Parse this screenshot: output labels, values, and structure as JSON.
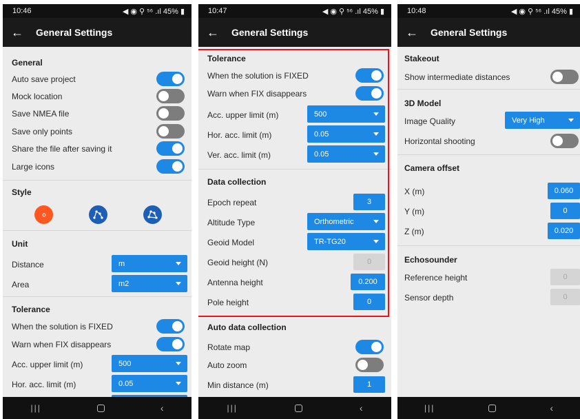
{
  "screen1": {
    "status": {
      "time": "10:46",
      "icons": "◀ ◉ ⚲ ⁵⁶ .ıl 45% ▮"
    },
    "title": "General Settings",
    "general": {
      "title": "General",
      "items": [
        {
          "label": "Auto save project",
          "on": true
        },
        {
          "label": "Mock location",
          "on": false
        },
        {
          "label": "Save NMEA file",
          "on": false
        },
        {
          "label": "Save only points",
          "on": false
        },
        {
          "label": "Share the file after saving it",
          "on": true
        },
        {
          "label": "Large icons",
          "on": true
        }
      ]
    },
    "style": {
      "title": "Style",
      "options": [
        {
          "icon": "point-style-icon",
          "color": "#ff5722"
        },
        {
          "icon": "line-style-icon",
          "color": "#1e5fb5"
        },
        {
          "icon": "polygon-style-icon",
          "color": "#1e5fb5"
        }
      ]
    },
    "unit": {
      "title": "Unit",
      "distance_label": "Distance",
      "distance_value": "m",
      "area_label": "Area",
      "area_value": "m2"
    },
    "tolerance": {
      "title": "Tolerance",
      "fixed_label": "When the solution is FIXED",
      "warn_label": "Warn when FIX disappears",
      "acc_label": "Acc. upper limit (m)",
      "acc_value": "500",
      "hor_label": "Hor. acc. limit (m)",
      "hor_value": "0.05"
    }
  },
  "screen2": {
    "status": {
      "time": "10:47",
      "icons": "◀ ◉ ⚲ ⁵⁶ .ıl 45% ▮"
    },
    "title": "General Settings",
    "tolerance": {
      "title": "Tolerance",
      "fixed_label": "When the solution is FIXED",
      "warn_label": "Warn when FIX disappears",
      "acc_label": "Acc. upper limit (m)",
      "acc_value": "500",
      "hor_label": "Hor. acc. limit (m)",
      "hor_value": "0.05",
      "ver_label": "Ver. acc. limit (m)",
      "ver_value": "0.05"
    },
    "data_collection": {
      "title": "Data collection",
      "epoch_label": "Epoch repeat",
      "epoch_value": "3",
      "altitude_label": "Altitude Type",
      "altitude_value": "Orthometric",
      "geoid_label": "Geoid Model",
      "geoid_value": "TR-TG20",
      "geoid_height_label": "Geoid height (N)",
      "geoid_height_value": "0",
      "antenna_label": "Antenna height",
      "antenna_value": "0.200",
      "pole_label": "Pole height",
      "pole_value": "0"
    },
    "auto": {
      "title": "Auto data collection",
      "rotate_label": "Rotate map",
      "zoom_label": "Auto zoom",
      "min_label": "Min distance (m)",
      "min_value": "1"
    }
  },
  "screen3": {
    "status": {
      "time": "10:48",
      "icons": "◀ ◉ ⚲ ⁵⁶ .ıl 45% ▮"
    },
    "title": "General Settings",
    "stakeout": {
      "title": "Stakeout",
      "show_label": "Show intermediate distances"
    },
    "model": {
      "title": "3D Model",
      "quality_label": "Image Quality",
      "quality_value": "Very High",
      "shooting_label": "Horizontal shooting"
    },
    "camera": {
      "title": "Camera offset",
      "x_label": "X (m)",
      "x_value": "0.060",
      "y_label": "Y (m)",
      "y_value": "0",
      "z_label": "Z (m)",
      "z_value": "0.020"
    },
    "echo": {
      "title": "Echosounder",
      "ref_label": "Reference height",
      "ref_value": "0",
      "depth_label": "Sensor depth",
      "depth_value": "0"
    }
  },
  "colors": {
    "accent": "#1e88e5",
    "toggle_off": "#7d7d7d",
    "highlight": "#e8141d",
    "point_style": "#ff5722"
  }
}
